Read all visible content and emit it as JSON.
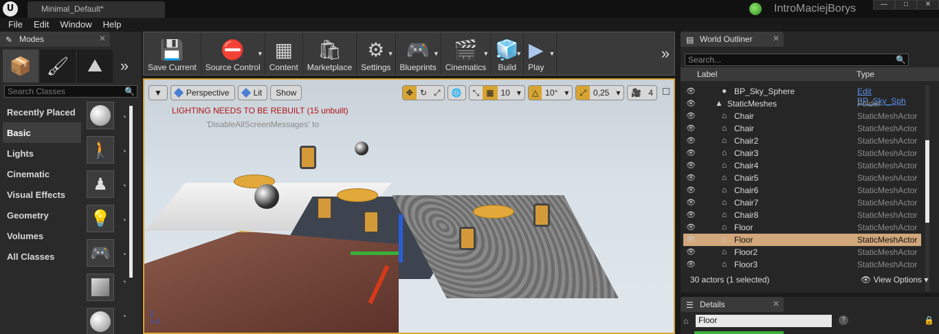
{
  "titlebar": {
    "logo": "U",
    "doc_tab": "Minimal_Default*",
    "project": "IntroMaciejBorys",
    "controls": [
      "—",
      "□",
      "✕"
    ]
  },
  "menu": [
    "File",
    "Edit",
    "Window",
    "Help"
  ],
  "modes": {
    "tab": "Modes",
    "search_placeholder": "Search Classes",
    "categories": [
      "Recently Placed",
      "Basic",
      "Lights",
      "Cinematic",
      "Visual Effects",
      "Geometry",
      "Volumes",
      "All Classes"
    ],
    "active_category": "Basic"
  },
  "toolbar": {
    "buttons": [
      "Save Current",
      "Source Control",
      "Content",
      "Marketplace",
      "Settings",
      "Blueprints",
      "Cinematics",
      "Build",
      "Play"
    ]
  },
  "viewport": {
    "perspective": "Perspective",
    "lit": "Lit",
    "show": "Show",
    "grid_snap": "10",
    "rot_snap": "10°",
    "scale_snap": "0,25",
    "cam_speed": "4",
    "warning": "LIGHTING NEEDS TO BE REBUILT (15 unbuilt)",
    "sub_warning": "'DisableAllScreenMessages' to"
  },
  "outliner": {
    "tab": "World Outliner",
    "search_placeholder": "Search...",
    "col_label": "Label",
    "col_type": "Type",
    "rows": [
      {
        "name": "BP_Sky_Sphere",
        "type": "Edit BP_Sky_Sph",
        "indent": 1,
        "icon": "●",
        "link": true
      },
      {
        "name": "StaticMeshes",
        "type": "Folder",
        "indent": 0,
        "icon": "▲"
      },
      {
        "name": "Chair",
        "type": "StaticMeshActor",
        "indent": 1,
        "icon": "⌂"
      },
      {
        "name": "Chair",
        "type": "StaticMeshActor",
        "indent": 1,
        "icon": "⌂"
      },
      {
        "name": "Chair2",
        "type": "StaticMeshActor",
        "indent": 1,
        "icon": "⌂"
      },
      {
        "name": "Chair3",
        "type": "StaticMeshActor",
        "indent": 1,
        "icon": "⌂"
      },
      {
        "name": "Chair4",
        "type": "StaticMeshActor",
        "indent": 1,
        "icon": "⌂"
      },
      {
        "name": "Chair5",
        "type": "StaticMeshActor",
        "indent": 1,
        "icon": "⌂"
      },
      {
        "name": "Chair6",
        "type": "StaticMeshActor",
        "indent": 1,
        "icon": "⌂"
      },
      {
        "name": "Chair7",
        "type": "StaticMeshActor",
        "indent": 1,
        "icon": "⌂"
      },
      {
        "name": "Chair8",
        "type": "StaticMeshActor",
        "indent": 1,
        "icon": "⌂"
      },
      {
        "name": "Floor",
        "type": "StaticMeshActor",
        "indent": 1,
        "icon": "⌂"
      },
      {
        "name": "Floor",
        "type": "StaticMeshActor",
        "indent": 1,
        "icon": "⌂",
        "selected": true
      },
      {
        "name": "Floor2",
        "type": "StaticMeshActor",
        "indent": 1,
        "icon": "⌂"
      },
      {
        "name": "Floor3",
        "type": "StaticMeshActor",
        "indent": 1,
        "icon": "⌂"
      }
    ],
    "footer": "30 actors (1 selected)",
    "view_options": "View Options"
  },
  "details": {
    "tab": "Details",
    "name": "Floor"
  },
  "colors": {
    "accent": "#d8a432",
    "selection": "#d1a77b",
    "warning": "#b01010"
  }
}
